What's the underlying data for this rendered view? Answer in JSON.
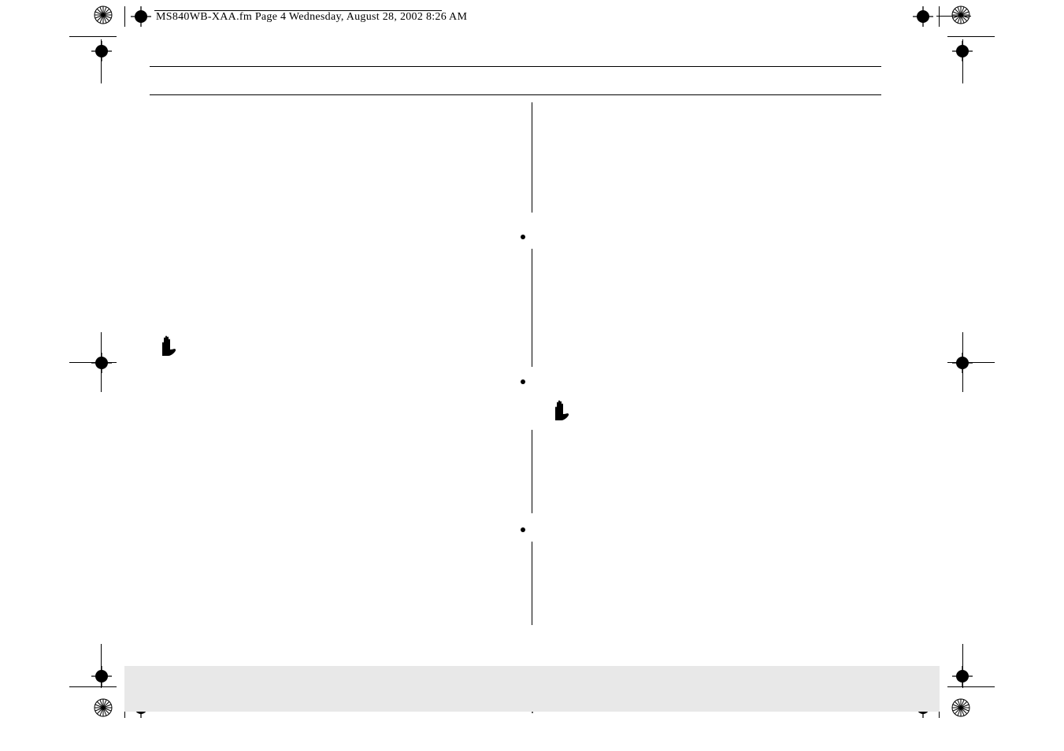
{
  "header_stamp": "MS840WB-XAA.fm  Page 4  Wednesday, August 28, 2002  8:26 AM",
  "icons": {
    "hand_left_name": "stop-hand-icon",
    "hand_right_name": "stop-hand-icon"
  },
  "marks": {
    "registration": "registration-mark-icon",
    "color_bar": "color-bar-icon"
  }
}
